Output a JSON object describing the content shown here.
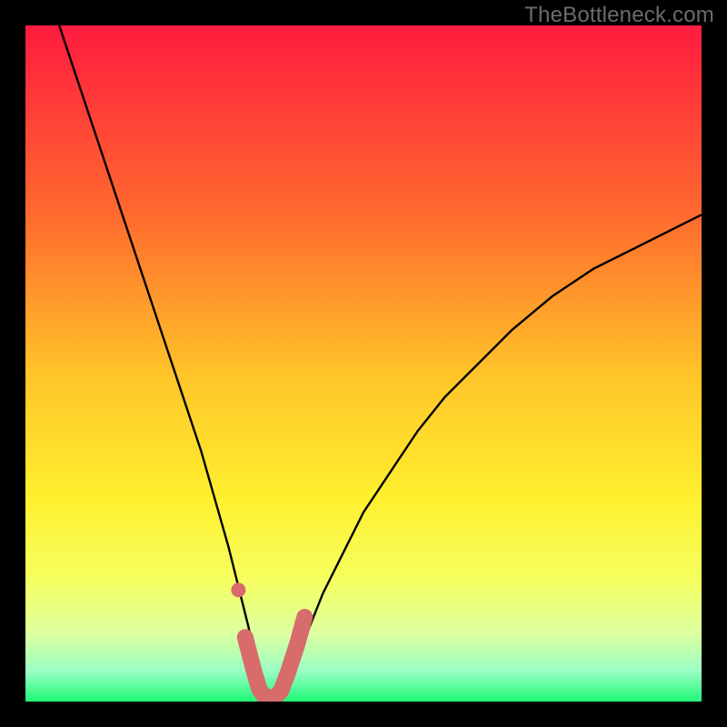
{
  "watermark": "TheBottleneck.com",
  "colors": {
    "frame_bg": "#000000",
    "grad_top": "#ff1b3f",
    "grad_upper_mid": "#ff8a2a",
    "grad_mid": "#ffe52b",
    "grad_lower_mid": "#f6ff5d",
    "grad_low": "#d6ff8b",
    "grad_bottom": "#1ef777",
    "curve": "#000000",
    "marker": "#d86b6b"
  },
  "chart_data": {
    "type": "line",
    "title": "",
    "xlabel": "",
    "ylabel": "",
    "xlim": [
      0,
      100
    ],
    "ylim": [
      0,
      100
    ],
    "grid": false,
    "legend": false,
    "annotations": [],
    "series": [
      {
        "name": "bottleneck-curve",
        "comment": "Approximate V-shaped curve; y is distance above bottom edge of gradient area as percentage of plot height. Values estimated from pixels.",
        "x": [
          5,
          8,
          11,
          14,
          17,
          20,
          23,
          26,
          28,
          30,
          31.5,
          33,
          34,
          35,
          36,
          37,
          38,
          40,
          42,
          44,
          47,
          50,
          54,
          58,
          62,
          67,
          72,
          78,
          84,
          90,
          96,
          100
        ],
        "y": [
          100,
          91,
          82,
          73,
          64,
          55,
          46,
          37,
          30,
          23,
          17,
          11,
          6,
          2,
          0.5,
          0.5,
          2,
          6,
          11,
          16,
          22,
          28,
          34,
          40,
          45,
          50,
          55,
          60,
          64,
          67,
          70,
          72
        ]
      }
    ],
    "markers": {
      "comment": "Thick salmon U-shaped marker segment near the trough plus one isolated dot slightly above-left.",
      "dot": {
        "x": 31.5,
        "y": 16.5
      },
      "u_path_x": [
        32.5,
        33.8,
        34.6,
        35.4,
        36.2,
        37.0,
        37.8,
        38.8,
        40.2,
        41.3
      ],
      "u_path_y": [
        9.5,
        4.5,
        1.8,
        0.7,
        0.6,
        0.7,
        1.6,
        4.2,
        8.5,
        12.5
      ]
    },
    "gradient_stops": [
      {
        "offset": 0.0,
        "color": "#ff1b3f"
      },
      {
        "offset": 0.28,
        "color": "#ff6a2e"
      },
      {
        "offset": 0.52,
        "color": "#ffc529"
      },
      {
        "offset": 0.7,
        "color": "#fff02f"
      },
      {
        "offset": 0.82,
        "color": "#f5ff60"
      },
      {
        "offset": 0.9,
        "color": "#dcffa0"
      },
      {
        "offset": 0.955,
        "color": "#9affc4"
      },
      {
        "offset": 1.0,
        "color": "#1ef777"
      }
    ]
  }
}
